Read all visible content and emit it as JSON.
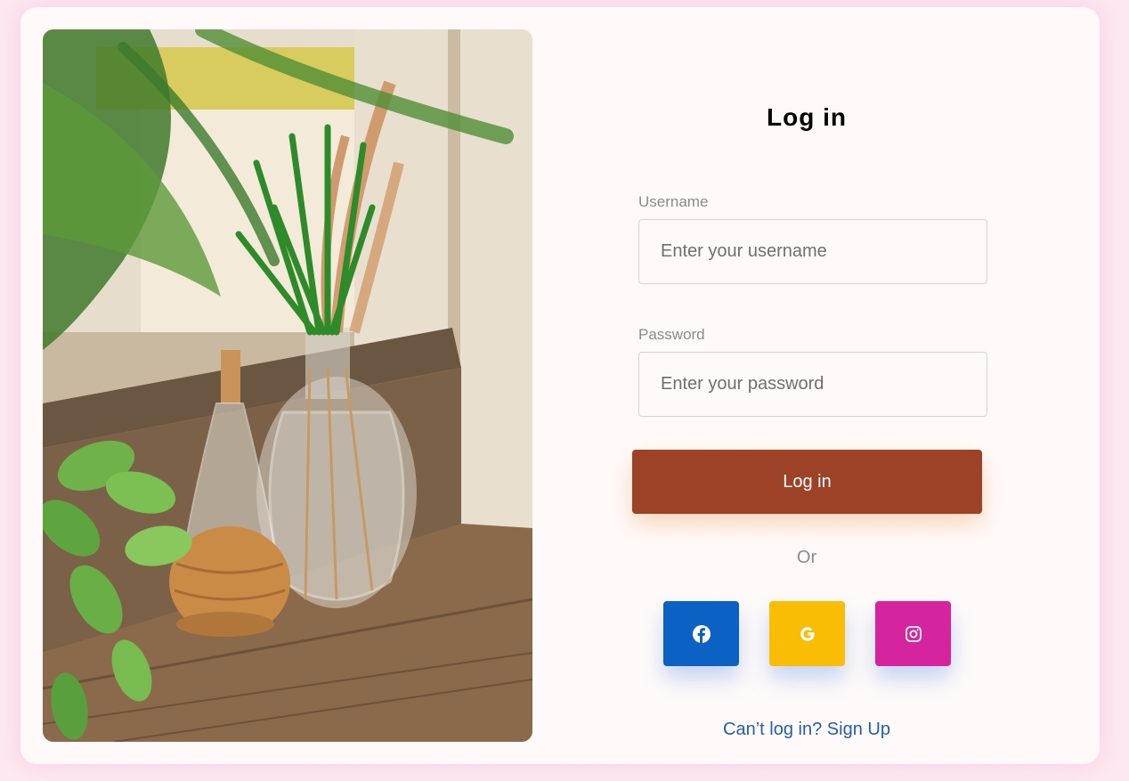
{
  "photo": {
    "description_icon": "plant-vases-photo"
  },
  "form": {
    "title": "Log in",
    "username_label": "Username",
    "username_placeholder": "Enter your username",
    "password_label": "Password",
    "password_placeholder": "Enter your password",
    "login_button": "Log in",
    "divider_text": "Or",
    "signup_link": "Can’t log in? Sign Up"
  },
  "social": [
    {
      "name": "facebook",
      "icon": "facebook-icon",
      "color": "#0b62c4"
    },
    {
      "name": "google",
      "icon": "google-icon",
      "color": "#fbbc05"
    },
    {
      "name": "instagram",
      "icon": "instagram-icon",
      "color": "#d6249f"
    }
  ],
  "colors": {
    "page_background": "#fde8f2",
    "card_background": "#fffaf9",
    "login_button": "#9d4226",
    "link": "#1f5eb5"
  }
}
